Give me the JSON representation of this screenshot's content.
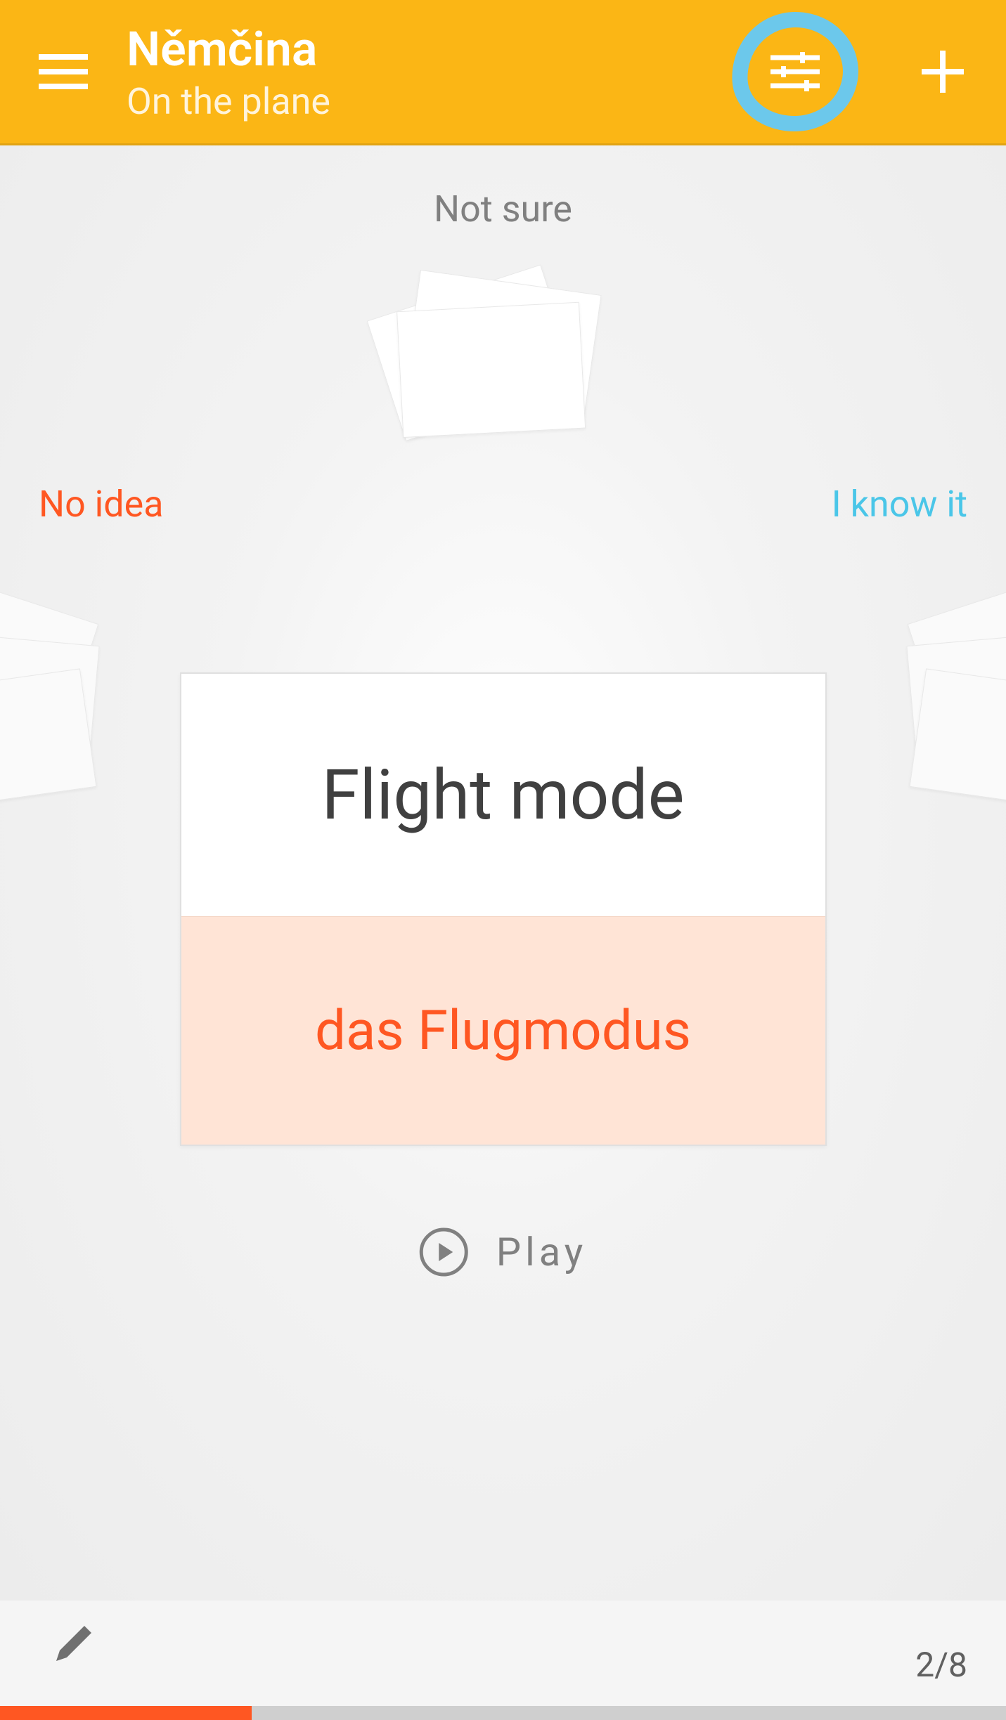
{
  "header": {
    "title": "Němčina",
    "subtitle": "On the plane"
  },
  "labels": {
    "top": "Not sure",
    "left": "No idea",
    "right": "I know it",
    "play": "Play"
  },
  "card": {
    "front": "Flight mode",
    "back": "das Flugmodus"
  },
  "progress": {
    "current": 2,
    "total": 8,
    "counter_text": "2/8",
    "percent": 25
  },
  "colors": {
    "accent": "#fbb615",
    "primary": "#ff5722",
    "info": "#4ac6e8",
    "highlight": "#6cc8eb"
  }
}
